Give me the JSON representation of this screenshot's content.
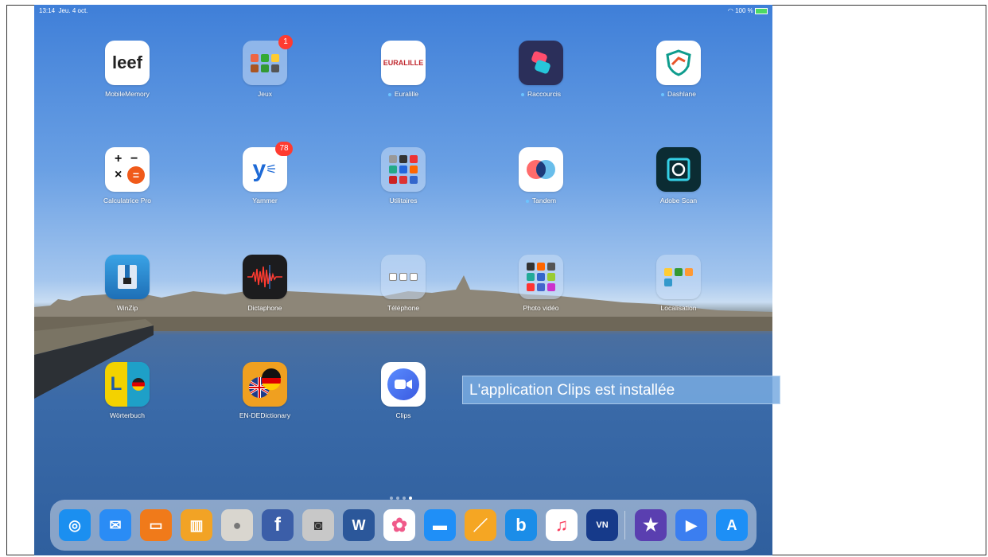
{
  "status": {
    "time": "13:14",
    "date": "Jeu. 4 oct.",
    "battery": "100 %"
  },
  "apps": [
    {
      "key": "mobilememory",
      "label": "MobileMemory",
      "icon_text": "leef",
      "color": "#ffffff",
      "text_color": "#222222"
    },
    {
      "key": "jeux",
      "label": "Jeux",
      "badge": "1",
      "folder": true
    },
    {
      "key": "euralille",
      "label": "Euralille",
      "icon_text": "EURALILLE",
      "color": "#ffffff",
      "text_color": "#c0282f",
      "dot": true
    },
    {
      "key": "raccourcis",
      "label": "Raccourcis",
      "color": "#2b2f5a",
      "dot": true
    },
    {
      "key": "dashlane",
      "label": "Dashlane",
      "color": "#ffffff",
      "dot": true
    },
    {
      "key": "calculatrice",
      "label": "Calculatrice Pro",
      "color": "#ffffff"
    },
    {
      "key": "yammer",
      "label": "Yammer",
      "icon_text": "y",
      "color": "#ffffff",
      "text_color": "#1e6ad6",
      "badge": "78"
    },
    {
      "key": "utilitaires",
      "label": "Utilitaires",
      "folder": true
    },
    {
      "key": "tandem",
      "label": "Tandem",
      "color": "#ffffff",
      "dot": true
    },
    {
      "key": "adobescan",
      "label": "Adobe Scan",
      "color": "#0b2c33"
    },
    {
      "key": "winzip",
      "label": "WinZip",
      "color": "#2a83c8"
    },
    {
      "key": "dictaphone",
      "label": "Dictaphone",
      "color": "#1c1c1e"
    },
    {
      "key": "telephone",
      "label": "Téléphone",
      "folder": true
    },
    {
      "key": "photovideo",
      "label": "Photo vidéo",
      "folder": true
    },
    {
      "key": "localisation",
      "label": "Localisation",
      "folder": true
    },
    {
      "key": "worterbuch",
      "label": "Wörterbuch",
      "icon_text": "L",
      "color": "#1ea0c8",
      "text_color": "#f3d200"
    },
    {
      "key": "endedictionary",
      "label": "EN-DEDictionary",
      "color": "#f0a020"
    },
    {
      "key": "clips",
      "label": "Clips",
      "color": "#ffffff"
    }
  ],
  "dock": [
    {
      "name": "safari",
      "color": "#1b8ff0",
      "glyph": "◎"
    },
    {
      "name": "mail",
      "color": "#2a8cf5",
      "glyph": "✉"
    },
    {
      "name": "app-orange",
      "color": "#f07a1a",
      "glyph": "▭"
    },
    {
      "name": "books",
      "color": "#f2a325",
      "glyph": "▥"
    },
    {
      "name": "contacts",
      "color": "#d9d6cf",
      "glyph": "●"
    },
    {
      "name": "facebook",
      "color": "#3b5ea8",
      "glyph": "f"
    },
    {
      "name": "camera",
      "color": "#c8c8c8",
      "glyph": "◙"
    },
    {
      "name": "word",
      "color": "#2b579a",
      "glyph": "W"
    },
    {
      "name": "photos",
      "color": "#ffffff",
      "glyph": "✿"
    },
    {
      "name": "files",
      "color": "#1f8ff7",
      "glyph": "▬"
    },
    {
      "name": "pages",
      "color": "#f5a623",
      "glyph": "／"
    },
    {
      "name": "app-b",
      "color": "#1b8de8",
      "glyph": "b"
    },
    {
      "name": "music",
      "color": "#ffffff",
      "glyph": "♫"
    },
    {
      "name": "la-voix-du-nord",
      "color": "#163a8a",
      "glyph": "VN"
    },
    {
      "name": "imovie",
      "color": "#5a3fb0",
      "glyph": "★"
    },
    {
      "name": "clips",
      "color": "#3b7ef0",
      "glyph": "▶"
    },
    {
      "name": "app-store",
      "color": "#1d8ff6",
      "glyph": "A"
    }
  ],
  "caption": "L'application Clips  est installée"
}
